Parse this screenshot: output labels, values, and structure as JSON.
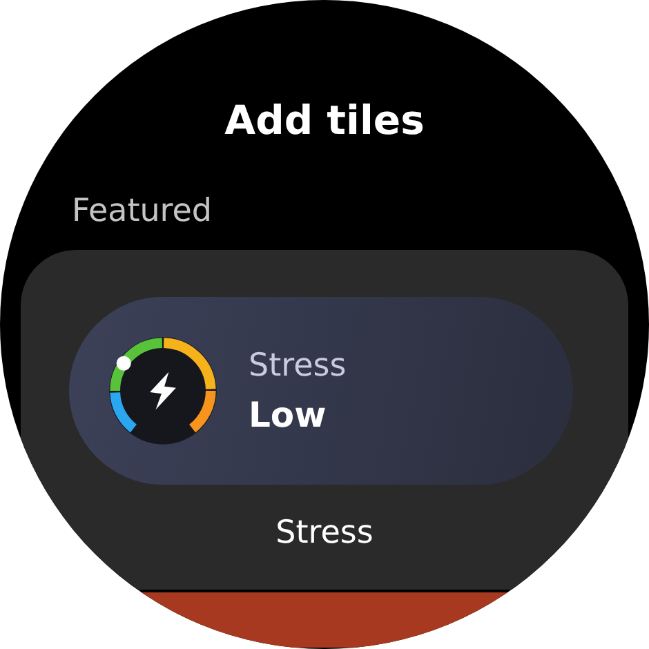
{
  "title": "Add tiles",
  "section": "Featured",
  "tile": {
    "label": "Stress",
    "value": "Low",
    "caption": "Stress"
  }
}
